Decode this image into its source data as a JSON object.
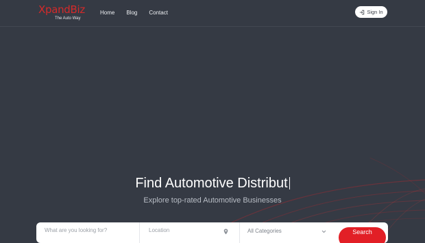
{
  "brand": {
    "name": "XpandBiz",
    "tagline": "The Auto Way",
    "color": "#d42a2a"
  },
  "nav": [
    {
      "label": "Home"
    },
    {
      "label": "Blog"
    },
    {
      "label": "Contact"
    }
  ],
  "signin": {
    "label": "Sign In",
    "icon": "signin-icon"
  },
  "hero": {
    "title": "Find Automotive Distribut",
    "subtitle": "Explore top-rated Automotive Businesses"
  },
  "search": {
    "keyword_placeholder": "What are you looking for?",
    "location_placeholder": "Location",
    "location_icon": "map-pin-icon",
    "category_value": "All Categories",
    "category_icon": "chevron-down-icon",
    "button_label": "Search",
    "button_color": "#e21f26"
  },
  "colors": {
    "background": "#353a44",
    "accent": "#e21f26"
  }
}
